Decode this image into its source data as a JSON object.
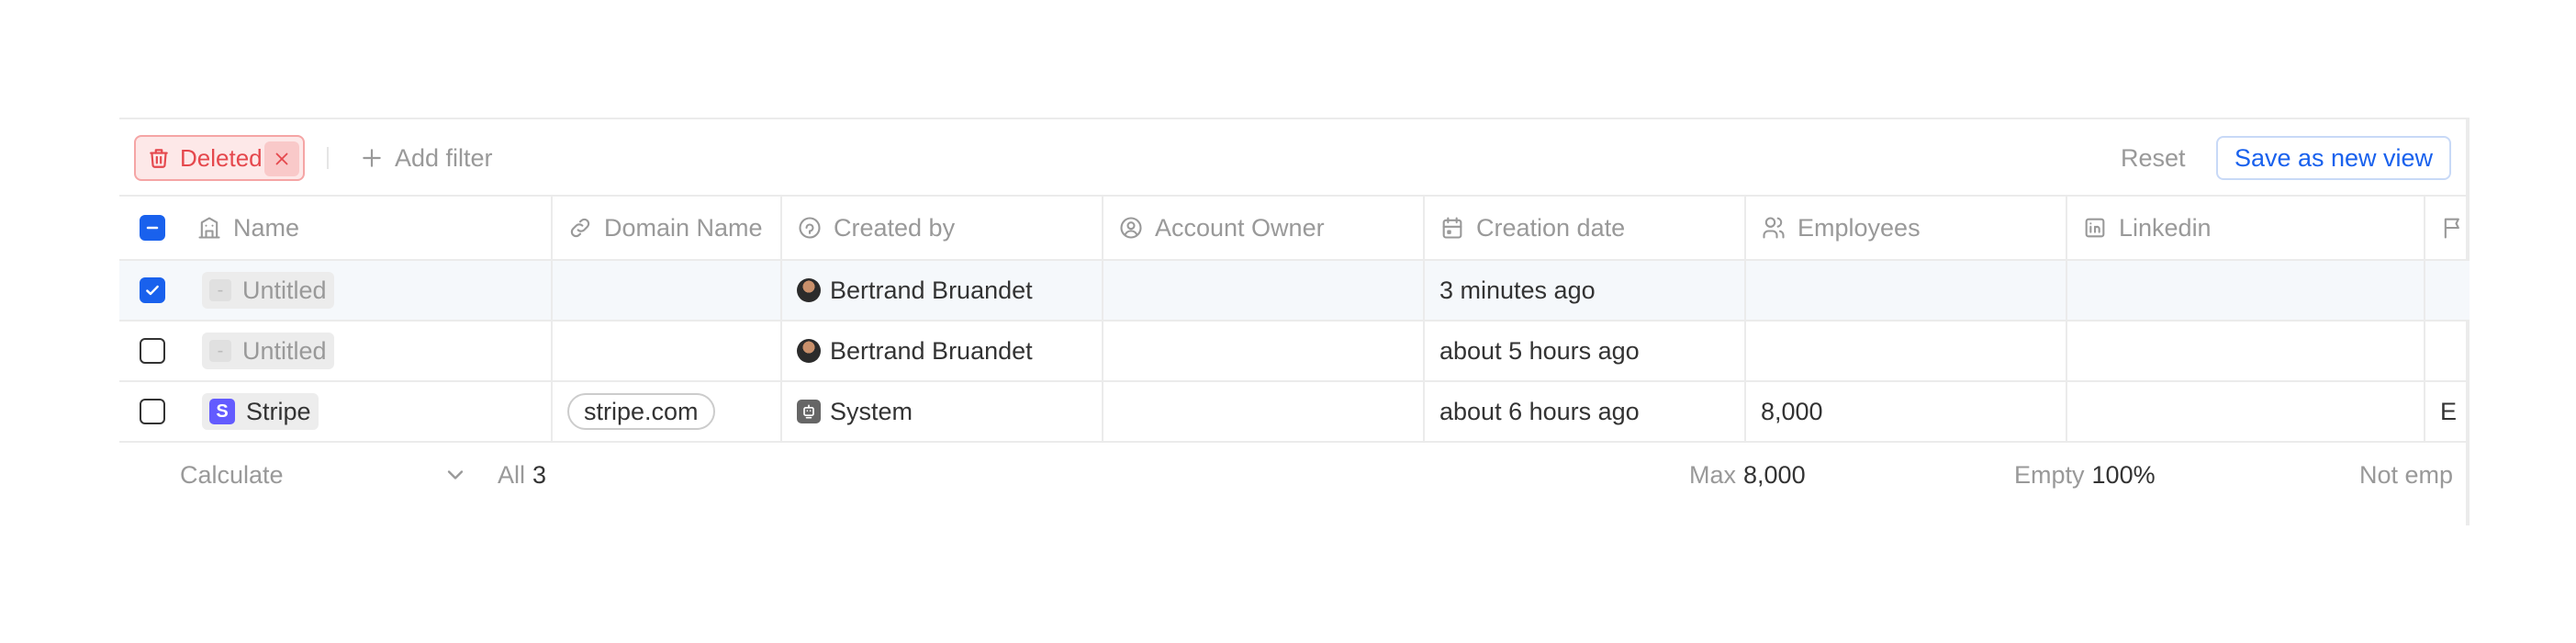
{
  "filter_bar": {
    "active_filter_label": "Deleted",
    "add_filter_label": "Add filter",
    "reset_label": "Reset",
    "save_view_label": "Save as new view"
  },
  "columns": [
    {
      "label": "Name",
      "icon": "building-icon"
    },
    {
      "label": "Domain Name",
      "icon": "link-icon"
    },
    {
      "label": "Created by",
      "icon": "created-by-icon"
    },
    {
      "label": "Account Owner",
      "icon": "user-circle-icon"
    },
    {
      "label": "Creation date",
      "icon": "calendar-icon"
    },
    {
      "label": "Employees",
      "icon": "users-icon"
    },
    {
      "label": "Linkedin",
      "icon": "linkedin-icon"
    },
    {
      "label": "",
      "icon": "flag-icon"
    }
  ],
  "rows": [
    {
      "selected": true,
      "name": "Untitled",
      "domain": "",
      "created_by": "Bertrand Bruandet",
      "account_owner": "",
      "creation_date": "3 minutes ago",
      "employees": "",
      "linkedin": "",
      "extra": ""
    },
    {
      "selected": false,
      "name": "Untitled",
      "domain": "",
      "created_by": "Bertrand Bruandet",
      "account_owner": "",
      "creation_date": "about 5 hours ago",
      "employees": "",
      "linkedin": "",
      "extra": ""
    },
    {
      "selected": false,
      "name": "Stripe",
      "name_logo": "S",
      "domain": "stripe.com",
      "created_by": "System",
      "account_owner": "",
      "creation_date": "about 6 hours ago",
      "employees": "8,000",
      "linkedin": "",
      "extra": "E"
    }
  ],
  "untitled_placeholder": "-",
  "footer": {
    "calculate_label": "Calculate",
    "all_label": "All",
    "all_count": "3",
    "max_label": "Max",
    "max_value": "8,000",
    "empty_label": "Empty",
    "empty_value": "100%",
    "not_empty_label": "Not emp"
  },
  "colors": {
    "accent": "#1961ed",
    "danger": "#e5484d",
    "stripe": "#635bff"
  }
}
